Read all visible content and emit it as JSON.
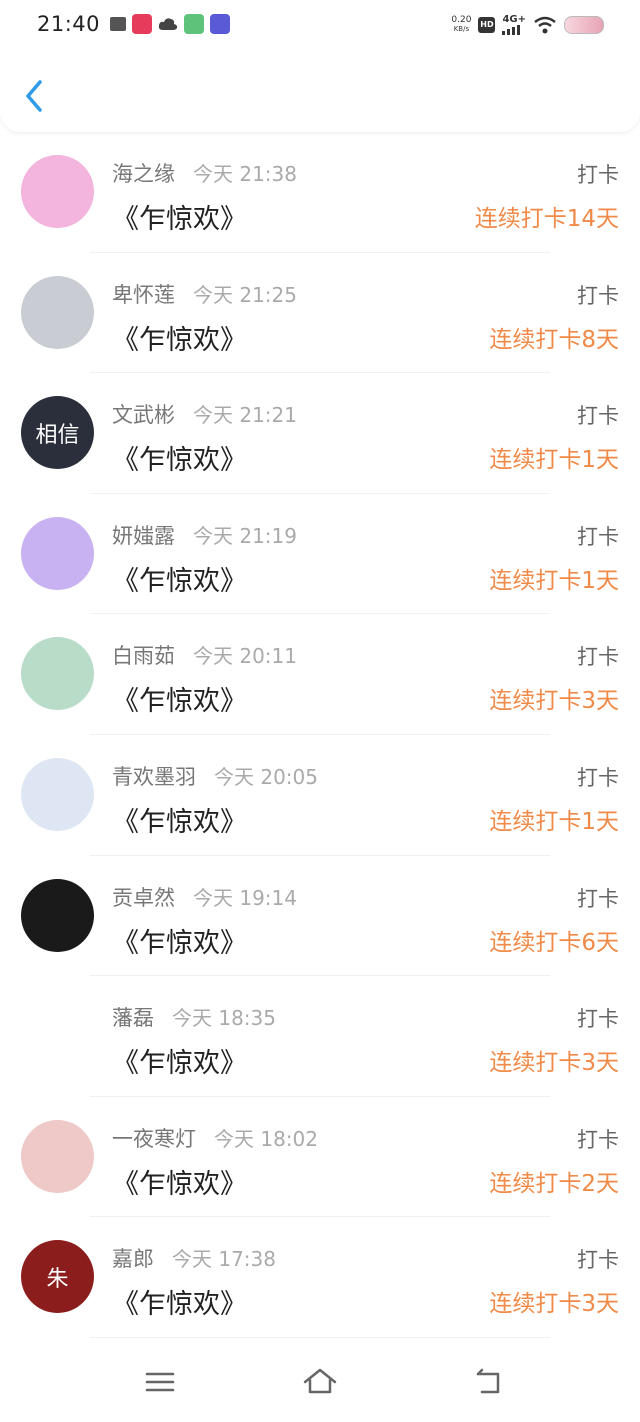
{
  "status_bar": {
    "time": "21:40",
    "left_icons": [
      "sim-icon",
      "app-badge-icon",
      "cloud-icon",
      "app-icon",
      "app-icon-2"
    ],
    "net_speed_value": "0.20",
    "net_speed_unit": "KB/s",
    "hd_label": "HD",
    "network_label": "4G+",
    "icons": [
      "signal-icon",
      "wifi-icon",
      "battery-icon"
    ]
  },
  "header": {
    "back_icon": "chevron-left-icon",
    "accent_color": "#2f9be8"
  },
  "checkins": [
    {
      "name": "海之缘",
      "time": "今天 21:38",
      "title": "《乍惊欢》",
      "action": "打卡",
      "streak": "连续打卡14天",
      "avatar_color": "#f3b4dd"
    },
    {
      "name": "卑怀莲",
      "time": "今天 21:25",
      "title": "《乍惊欢》",
      "action": "打卡",
      "streak": "连续打卡8天",
      "avatar_color": "#c9ccd3"
    },
    {
      "name": "文武彬",
      "time": "今天 21:21",
      "title": "《乍惊欢》",
      "action": "打卡",
      "streak": "连续打卡1天",
      "avatar_color": "#2a2f3b",
      "avatar_text": "相信"
    },
    {
      "name": "妍媸露",
      "time": "今天 21:19",
      "title": "《乍惊欢》",
      "action": "打卡",
      "streak": "连续打卡1天",
      "avatar_color": "#c8b2f2"
    },
    {
      "name": "白雨茹",
      "time": "今天 20:11",
      "title": "《乍惊欢》",
      "action": "打卡",
      "streak": "连续打卡3天",
      "avatar_color": "#b9dcc8"
    },
    {
      "name": "青欢墨羽",
      "time": "今天 20:05",
      "title": "《乍惊欢》",
      "action": "打卡",
      "streak": "连续打卡1天",
      "avatar_color": "#dfe6f3"
    },
    {
      "name": "贡卓然",
      "time": "今天 19:14",
      "title": "《乍惊欢》",
      "action": "打卡",
      "streak": "连续打卡6天",
      "avatar_color": "#1a1a1a"
    },
    {
      "name": "藩磊",
      "time": "今天 18:35",
      "title": "《乍惊欢》",
      "action": "打卡",
      "streak": "连续打卡3天",
      "avatar_color": ""
    },
    {
      "name": "一夜寒灯",
      "time": "今天 18:02",
      "title": "《乍惊欢》",
      "action": "打卡",
      "streak": "连续打卡2天",
      "avatar_color": "#eec9c7"
    },
    {
      "name": "嘉郎",
      "time": "今天 17:38",
      "title": "《乍惊欢》",
      "action": "打卡",
      "streak": "连续打卡3天",
      "avatar_color": "#8b1d1d",
      "avatar_text": "朱"
    }
  ],
  "colors": {
    "streak": "#f08a48",
    "name": "#777777",
    "time": "#aaaaaa",
    "title": "#222222"
  },
  "nav_bar": {
    "icons": [
      "menu-icon",
      "home-icon",
      "back-icon"
    ]
  }
}
